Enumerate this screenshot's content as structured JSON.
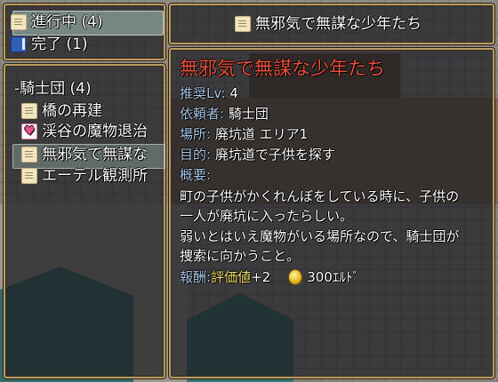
{
  "status_tabs": [
    {
      "label": "進行中 (4)",
      "icon": "scroll-icon"
    },
    {
      "label": "完了 (1)",
      "icon": "book-icon"
    }
  ],
  "quest_list": {
    "category": "-騎士団 (4)",
    "items": [
      {
        "label": "橋の再建",
        "icon": "scroll-icon"
      },
      {
        "label": "渓谷の魔物退治",
        "icon": "heart-icon"
      },
      {
        "label": "無邪気で無謀な",
        "icon": "scroll-icon"
      },
      {
        "label": "エーテル観測所",
        "icon": "scroll-icon"
      }
    ]
  },
  "title_bar": {
    "label": "無邪気で無謀な少年たち",
    "icon": "scroll-icon"
  },
  "detail": {
    "title": "無邪気で無謀な少年たち",
    "recommended_label": "推奨Lv:",
    "recommended_value": "4",
    "client_label": "依頼者:",
    "client_value": "騎士団",
    "location_label": "場所:",
    "location_value": "廃坑道 エリア1",
    "objective_label": "目的:",
    "objective_value": "廃坑道で子供を探す",
    "summary_label": "概要:",
    "summary_lines": [
      "町の子供がかくれんぼをしている時に、子供の",
      "一人が廃坑に入ったらしい。",
      "弱いとはいえ魔物がいる場所なので、騎士団が",
      "捜索に向かうこと。"
    ],
    "reward_label": "報酬:",
    "reward_rating": "評価値",
    "reward_rating_value": "+2",
    "reward_gold": "300ｴﾙﾄﾞ"
  },
  "colors": {
    "title": "#e8503a",
    "label": "#a9c8e8",
    "reward": "#f5e36a"
  }
}
